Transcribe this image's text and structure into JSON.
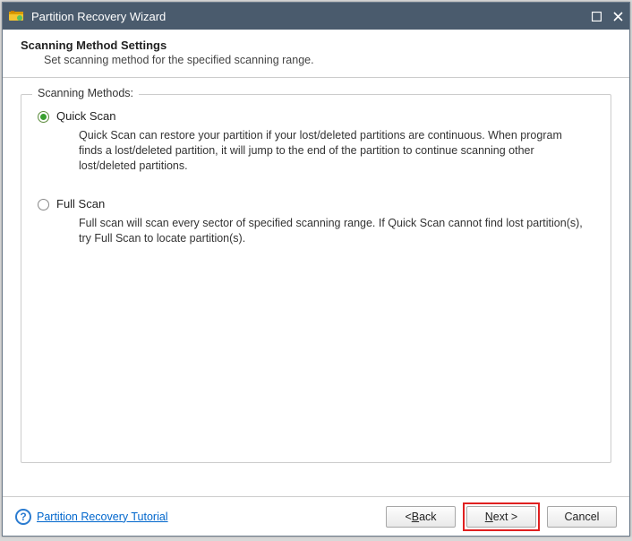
{
  "window": {
    "title": "Partition Recovery Wizard"
  },
  "header": {
    "title": "Scanning Method Settings",
    "subtitle": "Set scanning method for the specified scanning range."
  },
  "group": {
    "legend": "Scanning Methods:",
    "options": [
      {
        "label": "Quick Scan",
        "checked": true,
        "desc": "Quick Scan can restore your partition if your lost/deleted partitions are continuous. When program finds a lost/deleted partition, it will jump to the end of the partition to continue scanning other lost/deleted partitions."
      },
      {
        "label": "Full Scan",
        "checked": false,
        "desc": "Full scan will scan every sector of specified scanning range. If Quick Scan cannot find lost partition(s), try Full Scan to locate partition(s)."
      }
    ]
  },
  "footer": {
    "help_link": "Partition Recovery Tutorial",
    "back_prefix": "< ",
    "back_mn": "B",
    "back_suffix": "ack",
    "next_mn": "N",
    "next_suffix": "ext >",
    "cancel": "Cancel"
  }
}
